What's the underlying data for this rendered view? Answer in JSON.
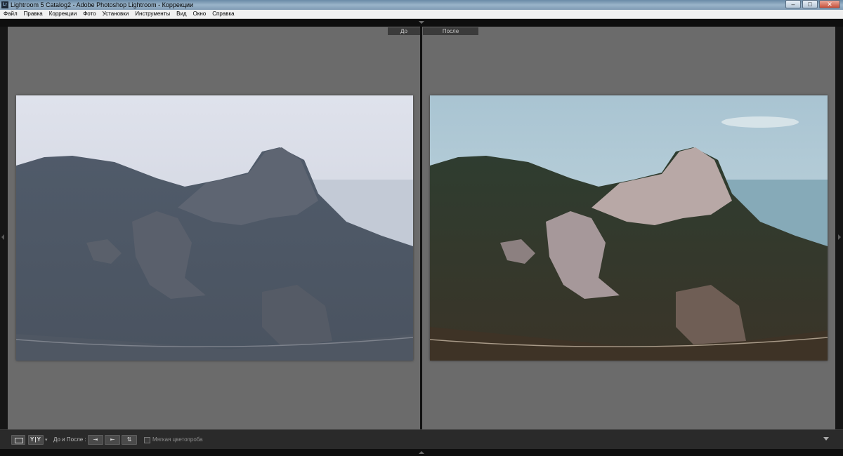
{
  "window": {
    "title": "Lightroom 5 Catalog2 - Adobe Photoshop Lightroom - Коррекции",
    "app_icon": "Lr",
    "controls": [
      "minimize",
      "maximize",
      "close"
    ]
  },
  "menu": [
    "Файл",
    "Правка",
    "Коррекции",
    "Фото",
    "Установки",
    "Инструменты",
    "Вид",
    "Окно",
    "Справка"
  ],
  "compare": {
    "before_label": "До",
    "after_label": "После"
  },
  "photos": {
    "before": {
      "subject": "mountain-landscape",
      "style": "flat-hazy"
    },
    "after": {
      "subject": "mountain-landscape",
      "style": "contrast-toned"
    }
  },
  "toolbar": {
    "yy_label": "Y|Y",
    "before_after_label": "До и После :",
    "soft_proofing_label": "Мягкая цветопроба",
    "soft_proofing_checked": false
  },
  "icons": {
    "loupe_view": "loupe-view-icon",
    "swap_settings": "copy-before-to-after-icon",
    "copy_after": "copy-after-to-before-icon",
    "swap": "swap-before-after-icon",
    "toolbar_menu": "chevron-down-icon"
  }
}
